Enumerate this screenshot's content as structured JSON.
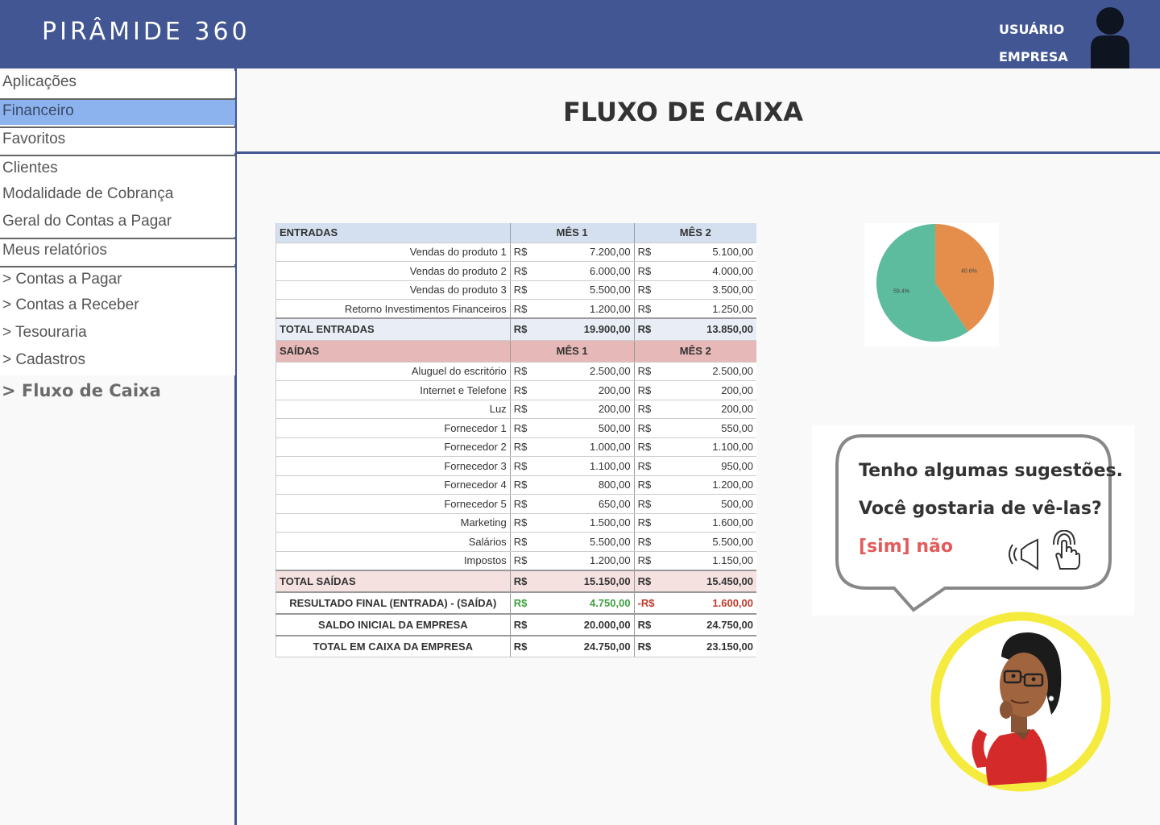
{
  "header": {
    "brand": "PIRÂMIDE 360",
    "user_label": "USUÁRIO",
    "company_label": "EMPRESA"
  },
  "sidebar": {
    "aplicacoes": "Aplicações",
    "financeiro": "Financeiro",
    "favoritos": "Favoritos",
    "clientes": "Clientes",
    "modalidade": "Modalidade de Cobrança",
    "geral": "Geral do Contas a Pagar",
    "meus_relatorios": "Meus relatórios",
    "contas_pagar": "> Contas a Pagar",
    "contas_receber": "> Contas a Receber",
    "tesouraria": "> Tesouraria",
    "cadastros": "> Cadastros",
    "fluxo": "> Fluxo de Caixa"
  },
  "page": {
    "title": "FLUXO DE CAIXA"
  },
  "table": {
    "entradas_header": "ENTRADAS",
    "saidas_header": "SAÍDAS",
    "mes1": "MÊS 1",
    "mes2": "MÊS 2",
    "currency": "R$",
    "entradas": [
      {
        "label": "Vendas do produto 1",
        "m1": "7.200,00",
        "m2": "5.100,00"
      },
      {
        "label": "Vendas do produto 2",
        "m1": "6.000,00",
        "m2": "4.000,00"
      },
      {
        "label": "Vendas do produto 3",
        "m1": "5.500,00",
        "m2": "3.500,00"
      },
      {
        "label": "Retorno Investimentos Financeiros",
        "m1": "1.200,00",
        "m2": "1.250,00"
      }
    ],
    "total_entradas": {
      "label": "TOTAL ENTRADAS",
      "m1": "19.900,00",
      "m2": "13.850,00"
    },
    "saidas": [
      {
        "label": "Aluguel do escritório",
        "m1": "2.500,00",
        "m2": "2.500,00"
      },
      {
        "label": "Internet e Telefone",
        "m1": "200,00",
        "m2": "200,00"
      },
      {
        "label": "Luz",
        "m1": "200,00",
        "m2": "200,00"
      },
      {
        "label": "Fornecedor 1",
        "m1": "500,00",
        "m2": "550,00"
      },
      {
        "label": "Fornecedor 2",
        "m1": "1.000,00",
        "m2": "1.100,00"
      },
      {
        "label": "Fornecedor 3",
        "m1": "1.100,00",
        "m2": "950,00"
      },
      {
        "label": "Fornecedor 4",
        "m1": "800,00",
        "m2": "1.200,00"
      },
      {
        "label": "Fornecedor 5",
        "m1": "650,00",
        "m2": "500,00"
      },
      {
        "label": "Marketing",
        "m1": "1.500,00",
        "m2": "1.600,00"
      },
      {
        "label": "Salários",
        "m1": "5.500,00",
        "m2": "5.500,00"
      },
      {
        "label": "Impostos",
        "m1": "1.200,00",
        "m2": "1.150,00"
      }
    ],
    "total_saidas": {
      "label": "TOTAL SAÍDAS",
      "m1": "15.150,00",
      "m2": "15.450,00"
    },
    "resultado": {
      "label": "RESULTADO FINAL (ENTRADA) - (SAÍDA)",
      "cur1": "R$",
      "m1": "4.750,00",
      "cur2": "-R$",
      "m2": "1.600,00"
    },
    "saldo_inicial": {
      "label": "SALDO INICIAL DA EMPRESA",
      "m1": "20.000,00",
      "m2": "24.750,00"
    },
    "total_caixa": {
      "label": "TOTAL EM CAIXA DA EMPRESA",
      "m1": "24.750,00",
      "m2": "23.150,00"
    }
  },
  "pie": {
    "slices": [
      {
        "label": "40.6%",
        "value": 40.6,
        "color": "#e58e4b"
      },
      {
        "label": "59.4%",
        "value": 59.4,
        "color": "#5dbb9e"
      }
    ]
  },
  "assistant": {
    "line1": "Tenho algumas sugestões.",
    "line2": "Você gostaria de vê-las?",
    "opt_yes": "[sim]",
    "opt_no": "não",
    "speaker_icon": "speaker-icon",
    "touch_icon": "touch-hand-icon"
  },
  "colors": {
    "header_bg": "#415693",
    "active_item": "#8db3ef",
    "option_text": "#e25c5c",
    "assistant_ring": "#f5ea3e"
  }
}
